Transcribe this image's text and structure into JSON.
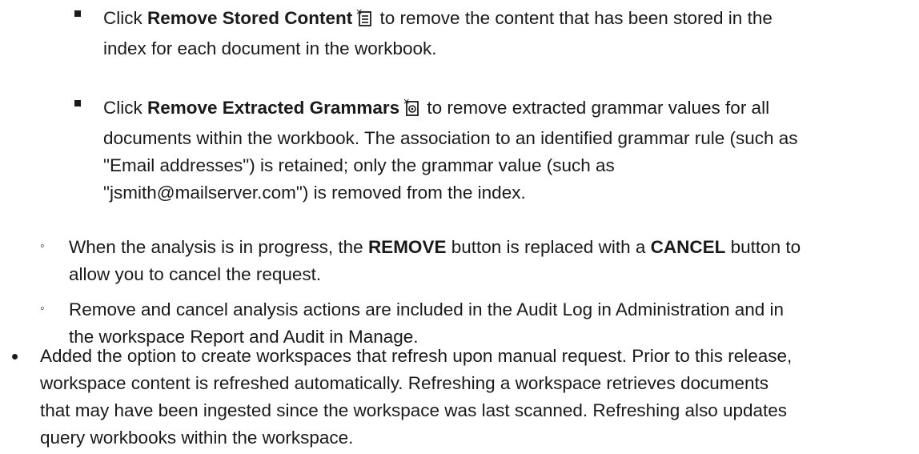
{
  "items": [
    {
      "bullet": "square",
      "lines": [
        {
          "pre": "Click ",
          "bold": "Remove Stored Content",
          "icon": "remove-stored-content-icon",
          "post": " to remove the content that has been stored in the"
        },
        {
          "text": "index for each document in the workbook."
        }
      ]
    },
    {
      "bullet": "square",
      "lines": [
        {
          "pre": "Click ",
          "bold": "Remove Extracted Grammars",
          "icon": "remove-extracted-grammars-icon",
          "post": " to remove extracted grammar values for all"
        },
        {
          "text": "documents within the workbook. The association to an identified grammar rule (such as"
        },
        {
          "text": "\"Email addresses\") is retained; only the grammar value (such as"
        },
        {
          "text": "\"jsmith@mailserver.com\") is removed from the index."
        }
      ]
    },
    {
      "bullet": "circle",
      "lines": [
        {
          "pre": "When the analysis is in progress, the ",
          "bold": "REMOVE",
          "mid": " button is replaced with a ",
          "bold2": "CANCEL",
          "post": " button to"
        },
        {
          "text": "allow you to cancel the request."
        }
      ]
    },
    {
      "bullet": "circle",
      "lines": [
        {
          "text": "Remove and cancel analysis actions are included in the Audit Log in Administration and in"
        },
        {
          "text": "the workspace Report and Audit in Manage."
        }
      ]
    },
    {
      "bullet": "dot",
      "lines": [
        {
          "text": "Added the option to create workspaces that refresh upon manual request. Prior to this release,"
        },
        {
          "text": "workspace content is refreshed automatically. Refreshing a workspace retrieves documents"
        },
        {
          "text": "that may have been ingested since the workspace was last scanned. Refreshing also updates"
        },
        {
          "text": "query workbooks within the workspace."
        }
      ]
    }
  ],
  "glyphs": {
    "circle": "◦",
    "dot": "•"
  }
}
